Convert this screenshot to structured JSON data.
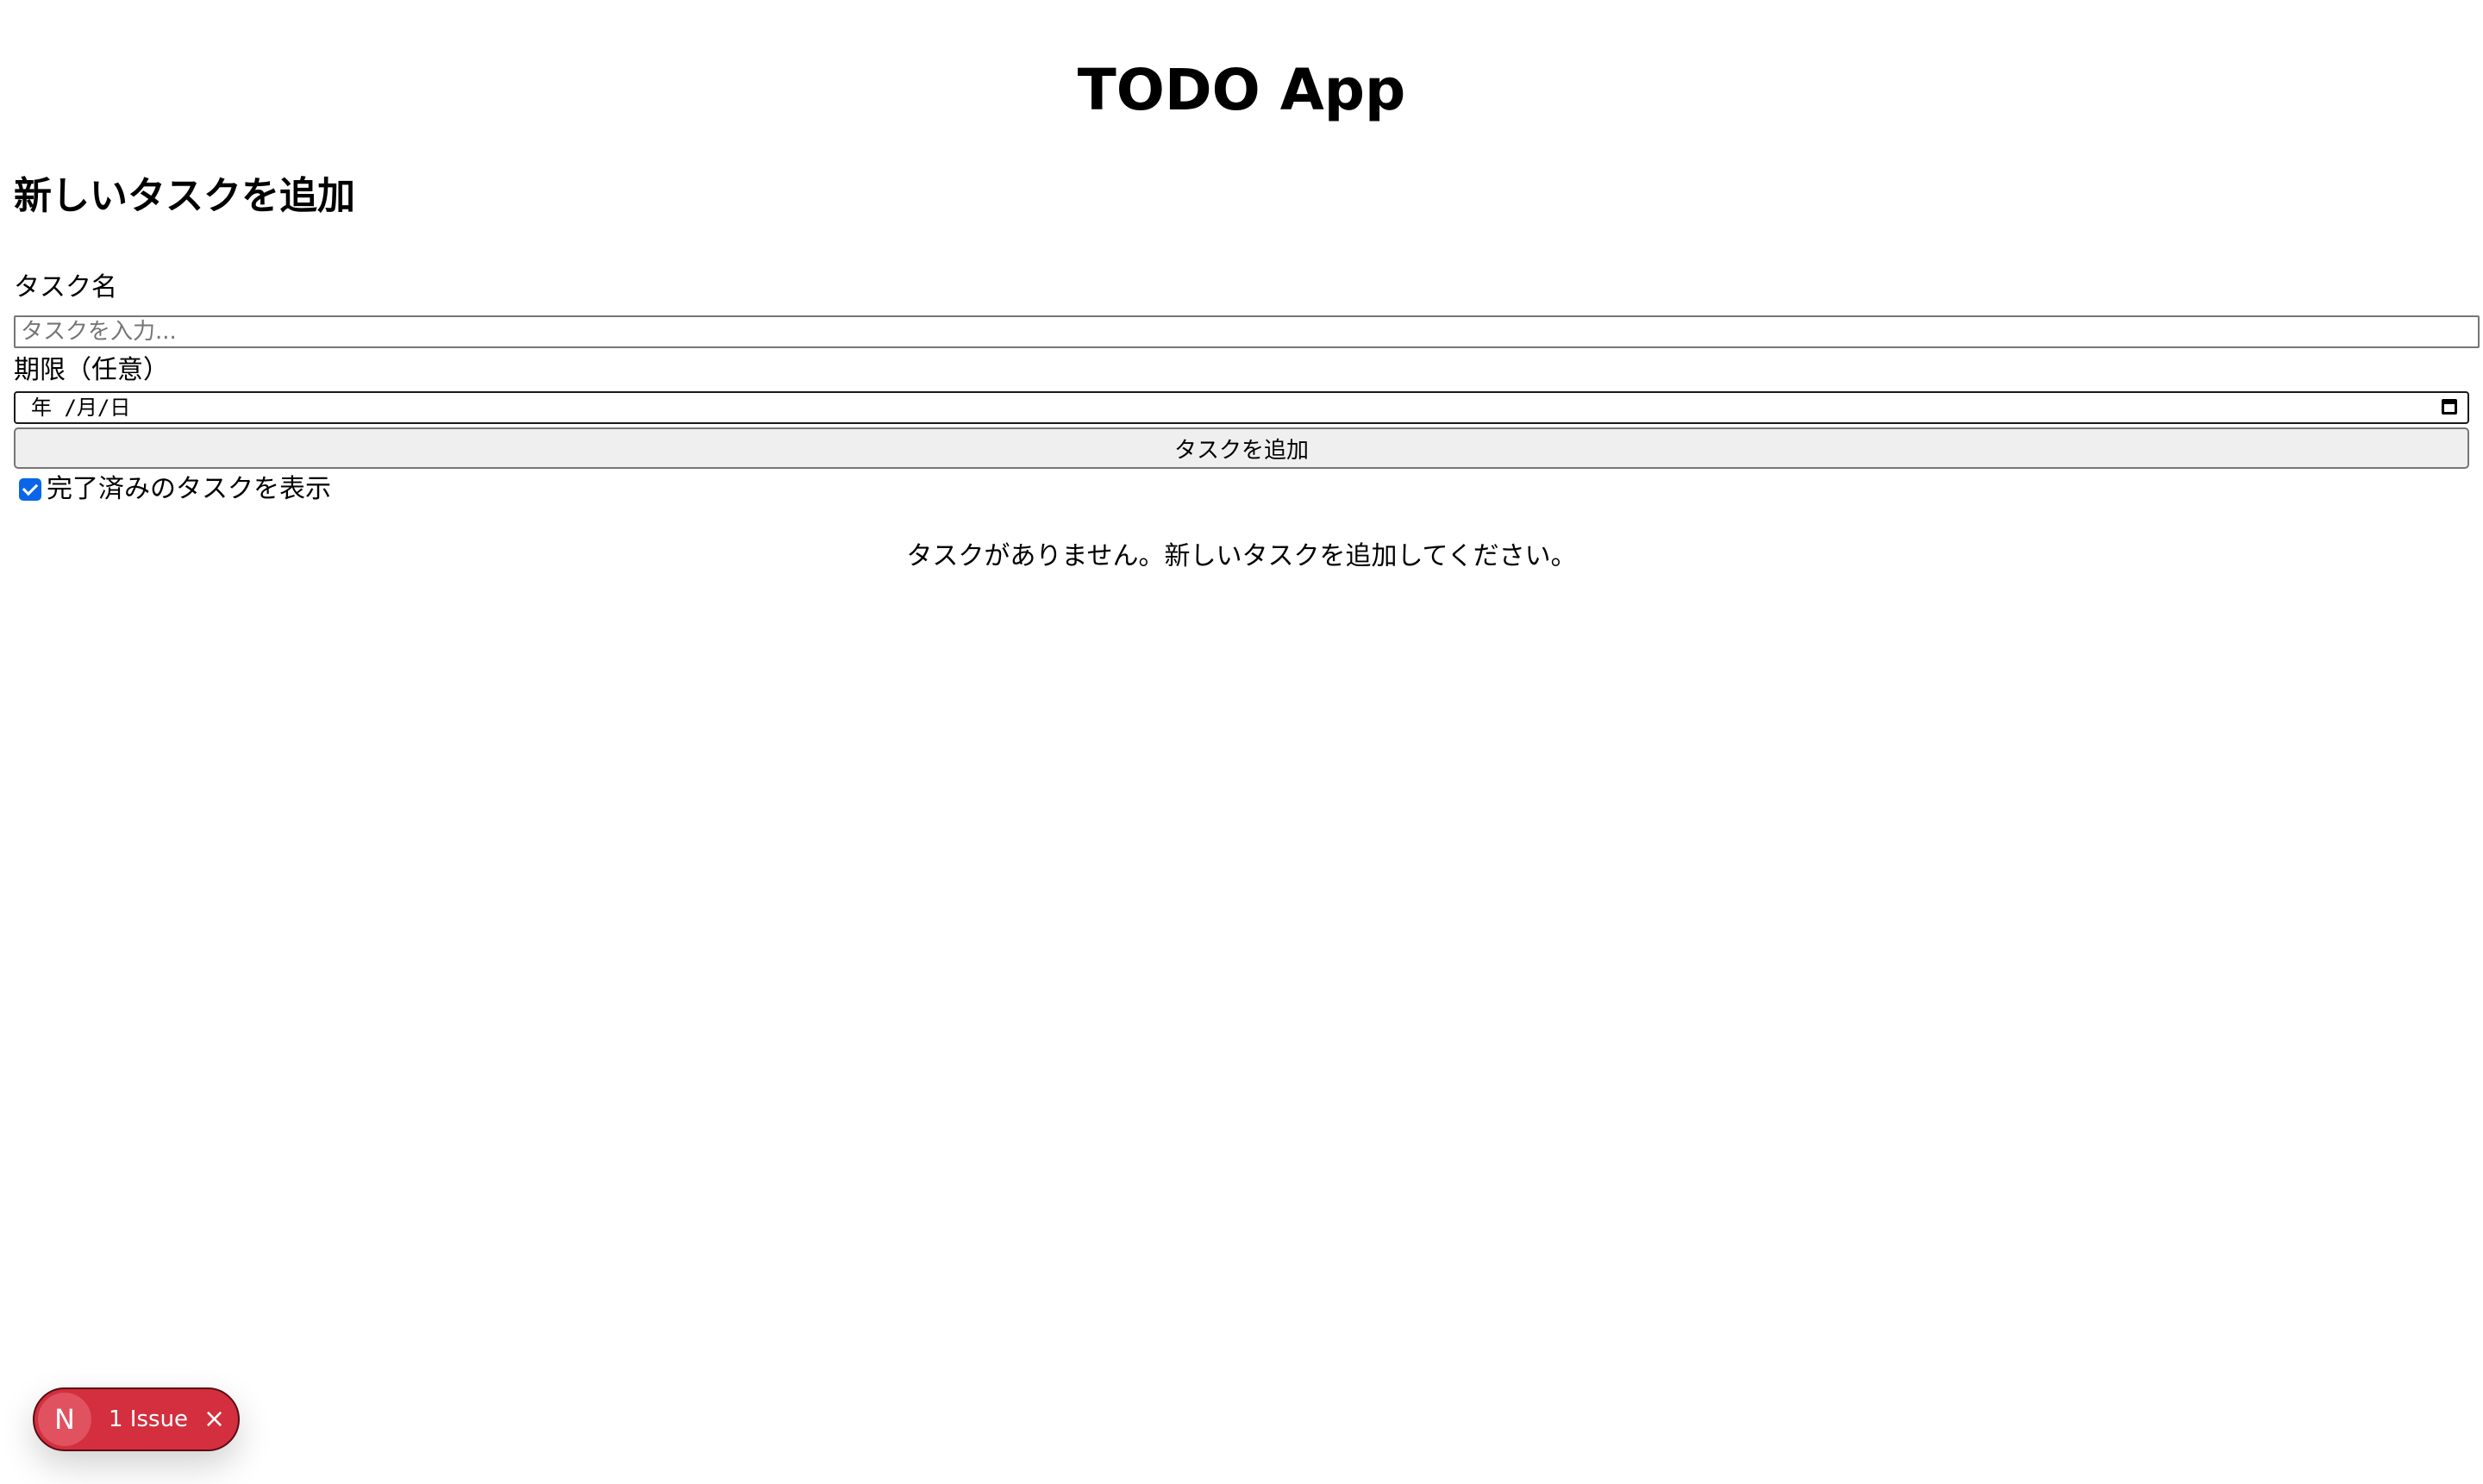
{
  "app": {
    "title": "TODO App"
  },
  "form": {
    "heading": "新しいタスクを追加",
    "task_name_label": "タスク名",
    "task_name_placeholder": "タスクを入力...",
    "task_name_value": "",
    "due_label": "期限（任意）",
    "due_value_display": "年 /月/日",
    "submit_label": "タスクを追加"
  },
  "filter": {
    "show_completed_label": "完了済みのタスクを表示",
    "show_completed_checked": true
  },
  "tasks": {
    "items": [],
    "empty_message": "タスクがありません。新しいタスクを追加してください。"
  },
  "dev_overlay": {
    "logo_letter": "N",
    "issue_label": "1 Issue",
    "close_glyph": "×",
    "badge_color": "#d32f3f"
  },
  "icons": {
    "calendar": "calendar-icon",
    "close": "close-icon",
    "checkbox": "checkbox-checked-icon"
  }
}
